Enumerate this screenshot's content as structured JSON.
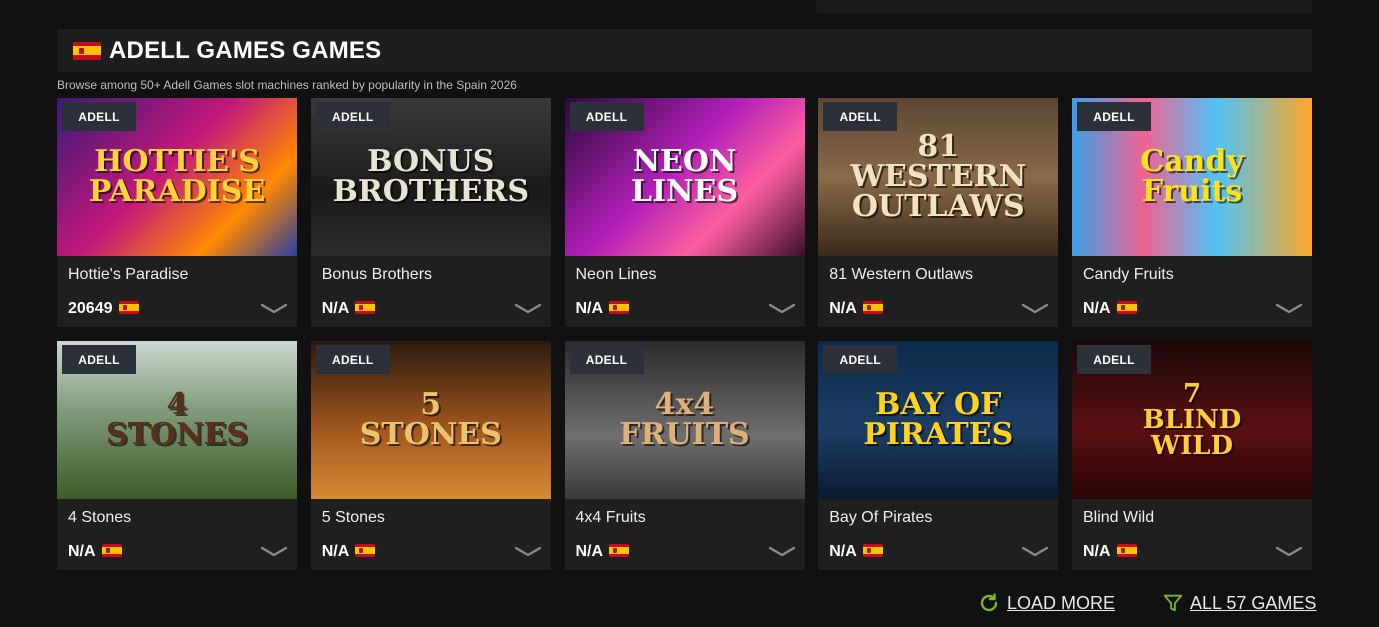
{
  "section": {
    "flag": "spain-flag-icon",
    "title": "ADELL GAMES GAMES",
    "subtitle": "Browse among 50+ Adell Games slot machines ranked by popularity in the Spain 2026"
  },
  "games": [
    {
      "name": "Hottie's Paradise",
      "score": "20649",
      "badge": "ADELL",
      "art": "HOTTIE'S\nPARADISE",
      "bg": "linear-gradient(135deg,#3a1a7a,#c2187a 45%,#ff8a00 75%,#2a3fa0)",
      "fg": "#ffd43b"
    },
    {
      "name": "Bonus Brothers",
      "score": "N/A",
      "badge": "ADELL",
      "art": "BONUS\nBROTHERS",
      "bg": "linear-gradient(180deg,#3a3a3a,#1a1a1a 60%,#2b2b2b)",
      "fg": "#e9e3d2"
    },
    {
      "name": "Neon Lines",
      "score": "N/A",
      "badge": "ADELL",
      "art": "NEON\nLINES",
      "bg": "linear-gradient(135deg,#2a0b3a,#b21fb8 45%,#ff5fa2 70%,#3b0f2a)",
      "fg": "#ffffff"
    },
    {
      "name": "81 Western Outlaws",
      "score": "N/A",
      "badge": "ADELL",
      "art": "81 WESTERN\nOUTLAWS",
      "bg": "linear-gradient(180deg,#5a4634,#8a6a48 50%,#3a2a1c)",
      "fg": "#f1e2c0"
    },
    {
      "name": "Candy Fruits",
      "score": "N/A",
      "badge": "ADELL",
      "art": "Candy\nFruits",
      "bg": "linear-gradient(90deg,#3aa0e8,#f06292 30%,#4fc3f7 60%,#ffa726)",
      "fg": "#ffe11a"
    },
    {
      "name": "4 Stones",
      "score": "N/A",
      "badge": "ADELL",
      "art": "4\nSTONES",
      "bg": "linear-gradient(180deg,#cfd6cf,#7e9a7a 45%,#3d5a2a)",
      "fg": "#5a3018"
    },
    {
      "name": "5 Stones",
      "score": "N/A",
      "badge": "ADELL",
      "art": "5\nSTONES",
      "bg": "linear-gradient(180deg,#2a1a10,#a0561e 55%,#d78a35)",
      "fg": "#e8c46a"
    },
    {
      "name": "4x4 Fruits",
      "score": "N/A",
      "badge": "ADELL",
      "art": "4x4\nFRUITS",
      "bg": "linear-gradient(180deg,#2a2a2a,#6f6f6f 60%,#3a3a3a)",
      "fg": "#e0b078"
    },
    {
      "name": "Bay Of Pirates",
      "score": "N/A",
      "badge": "ADELL",
      "art": "BAY OF\nPIRATES",
      "bg": "linear-gradient(180deg,#0b2a4a,#1c3e66 55%,#0a1a2e)",
      "fg": "#ffd21f"
    },
    {
      "name": "Blind Wild",
      "score": "N/A",
      "badge": "ADELL",
      "art": "7\nBLIND\nWILD",
      "bg": "linear-gradient(180deg,#1a0808,#5a0f12 55%,#2a0606)",
      "fg": "#ffcf3a"
    }
  ],
  "footer": {
    "load_more_label": "LOAD MORE",
    "all_games_label": "ALL 57 GAMES",
    "load_more_icon": "refresh-icon",
    "all_games_icon": "filter-icon",
    "accent": "#7bb62a"
  }
}
